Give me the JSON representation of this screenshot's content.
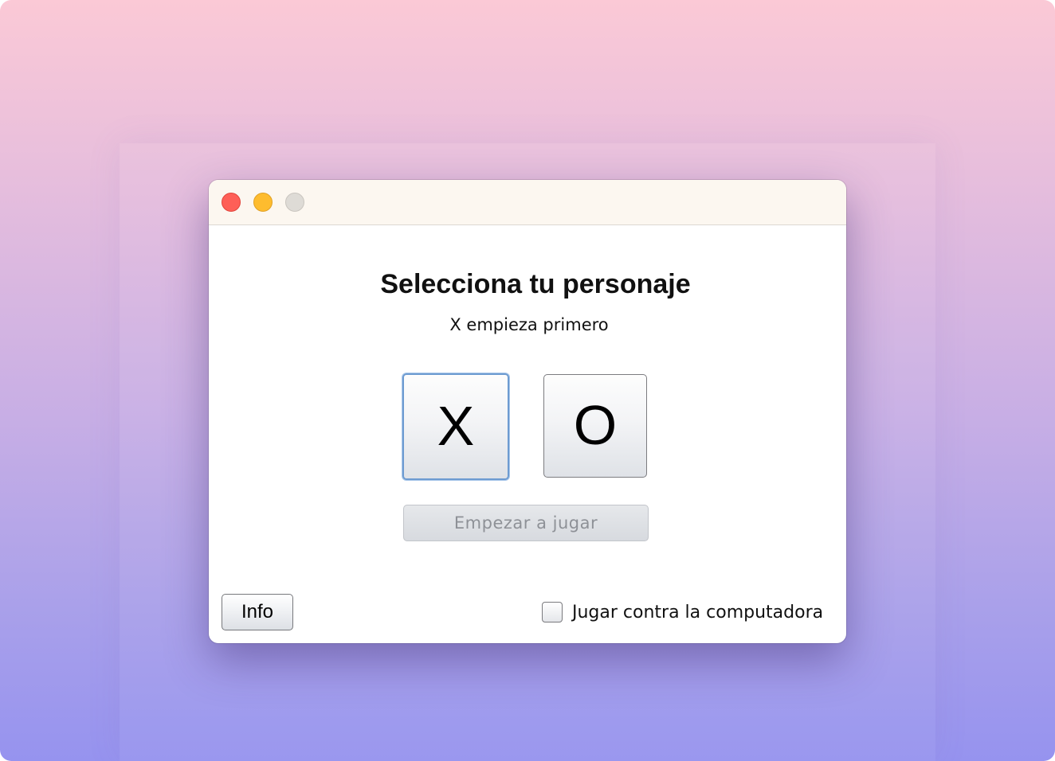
{
  "window": {
    "controls": {
      "close": "close-icon",
      "minimize": "minimize-icon",
      "zoom": "zoom-icon"
    }
  },
  "main": {
    "title": "Selecciona tu personaje",
    "subtitle": "X empieza primero",
    "choices": [
      {
        "label": "X",
        "selected": true
      },
      {
        "label": "O",
        "selected": false
      }
    ],
    "start_button": {
      "label": "Empezar a jugar",
      "enabled": false
    }
  },
  "footer": {
    "info_button": "Info",
    "vs_computer": {
      "label": "Jugar contra la computadora",
      "checked": false
    }
  },
  "colors": {
    "traffic_close": "#fe5f57",
    "traffic_minimize": "#febc2e",
    "traffic_zoom": "#dedbd6",
    "selection_accent": "#6d9bd1"
  }
}
